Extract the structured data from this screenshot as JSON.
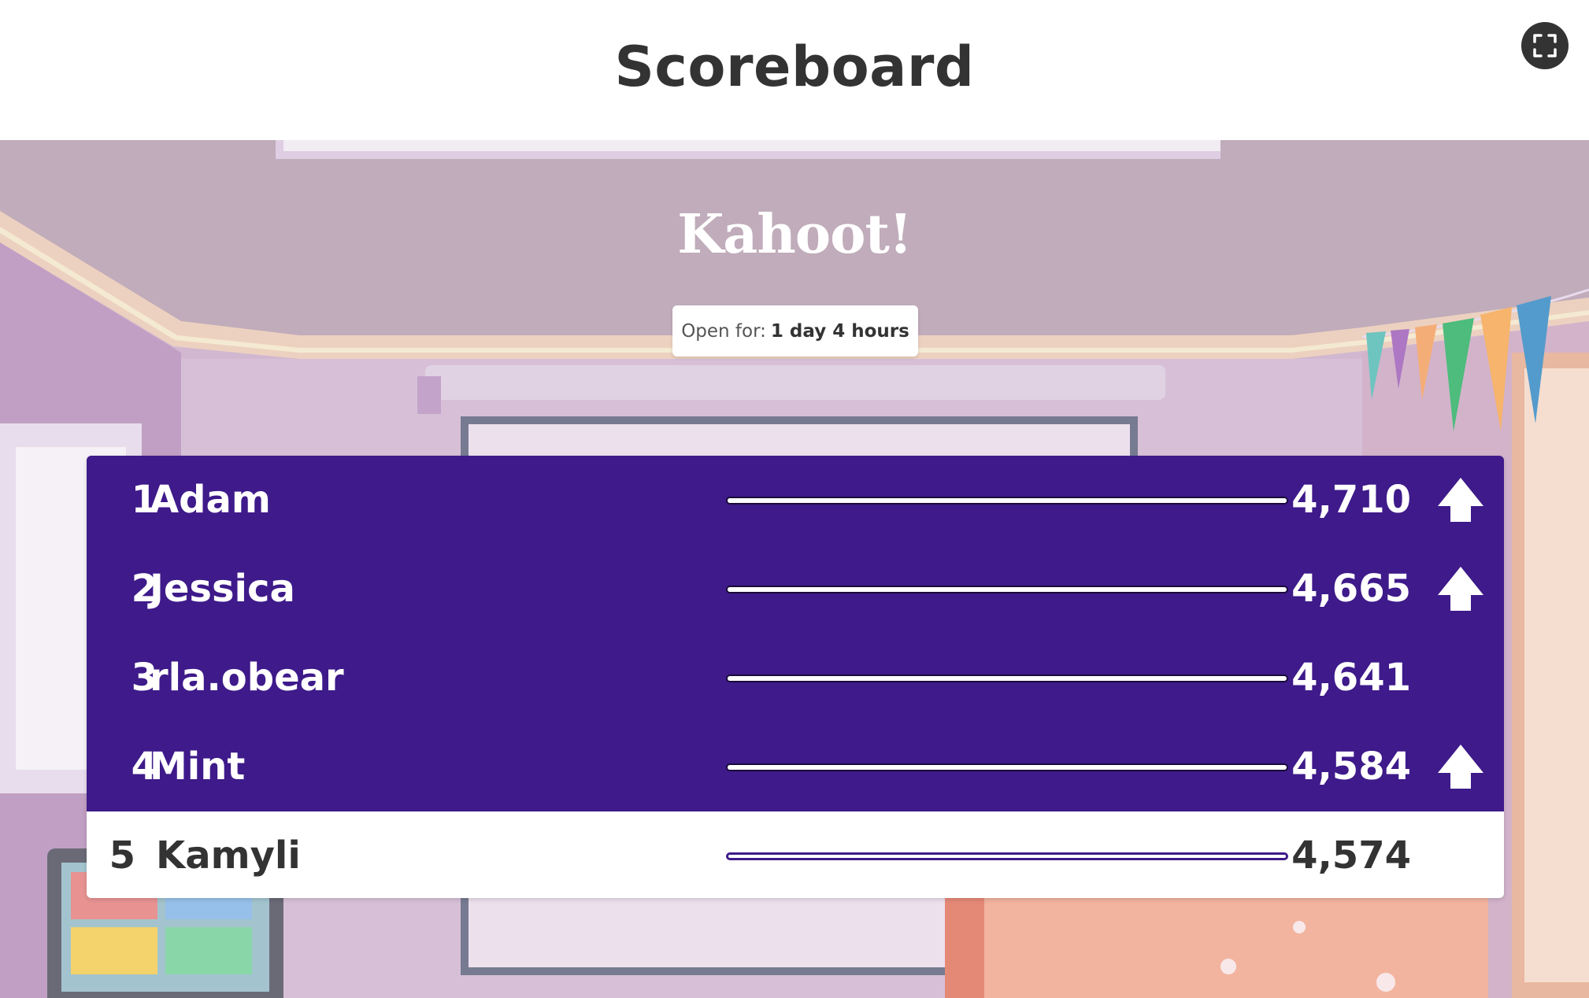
{
  "header": {
    "title": "Scoreboard",
    "fullscreen_icon": "fullscreen-icon"
  },
  "logo": {
    "text": "Kahoot!"
  },
  "open_badge": {
    "label": "Open for:",
    "value": "1 day 4 hours"
  },
  "scoreboard": {
    "rows": [
      {
        "rank": "1",
        "name": "Adam",
        "score": "4,710",
        "moved_up": true,
        "highlight": false,
        "progress": 1.0
      },
      {
        "rank": "2",
        "name": "Jessica",
        "score": "4,665",
        "moved_up": true,
        "highlight": false,
        "progress": 0.99
      },
      {
        "rank": "3",
        "name": "rla.obear",
        "score": "4,641",
        "moved_up": false,
        "highlight": false,
        "progress": 0.985
      },
      {
        "rank": "4",
        "name": "Mint",
        "score": "4,584",
        "moved_up": true,
        "highlight": false,
        "progress": 0.973
      },
      {
        "rank": "5",
        "name": "Kamyli",
        "score": "4,574",
        "moved_up": false,
        "highlight": true,
        "progress": 0.971
      }
    ]
  },
  "colors": {
    "board_purple": "#3e1a8a",
    "highlight_row": "#ffffff",
    "title_text": "#333333"
  }
}
